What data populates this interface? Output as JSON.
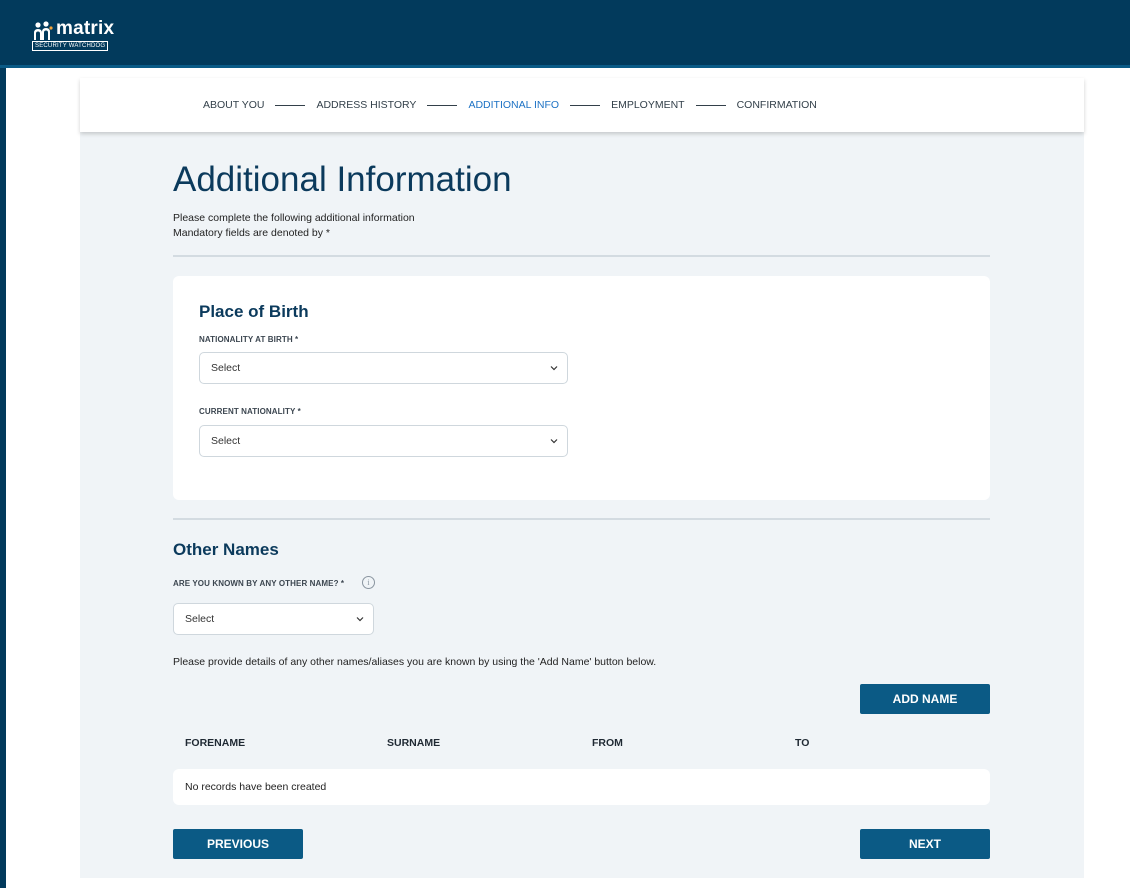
{
  "header": {
    "brand": "matrix",
    "brand_sub": "SECURITY WATCHDOG",
    "colors": {
      "bar": "#023a5c",
      "accent": "#0b5a85",
      "active_step": "#1d72c4"
    }
  },
  "stepper": {
    "steps": [
      {
        "label": "ABOUT YOU",
        "active": false
      },
      {
        "label": "ADDRESS HISTORY",
        "active": false
      },
      {
        "label": "ADDITIONAL INFO",
        "active": true
      },
      {
        "label": "EMPLOYMENT",
        "active": false
      },
      {
        "label": "CONFIRMATION",
        "active": false
      }
    ]
  },
  "page": {
    "title": "Additional Information",
    "intro_line1": "Please complete the following additional information",
    "intro_line2": "Mandatory fields are denoted by *"
  },
  "place_of_birth": {
    "title": "Place of Birth",
    "nationality_at_birth": {
      "label": "NATIONALITY AT BIRTH *",
      "value": "Select"
    },
    "current_nationality": {
      "label": "CURRENT NATIONALITY *",
      "value": "Select"
    }
  },
  "other_names": {
    "title": "Other Names",
    "known_by_other_name": {
      "label": "ARE YOU KNOWN BY ANY OTHER NAME? *",
      "value": "Select",
      "info_icon": "info-icon"
    },
    "hint": "Please provide details of any other names/aliases you are known by using the 'Add Name' button below.",
    "add_button": "ADD NAME",
    "table": {
      "columns": [
        "FORENAME",
        "SURNAME",
        "FROM",
        "TO"
      ],
      "empty_message": "No records have been created"
    }
  },
  "footer": {
    "previous": "PREVIOUS",
    "next": "NEXT"
  }
}
